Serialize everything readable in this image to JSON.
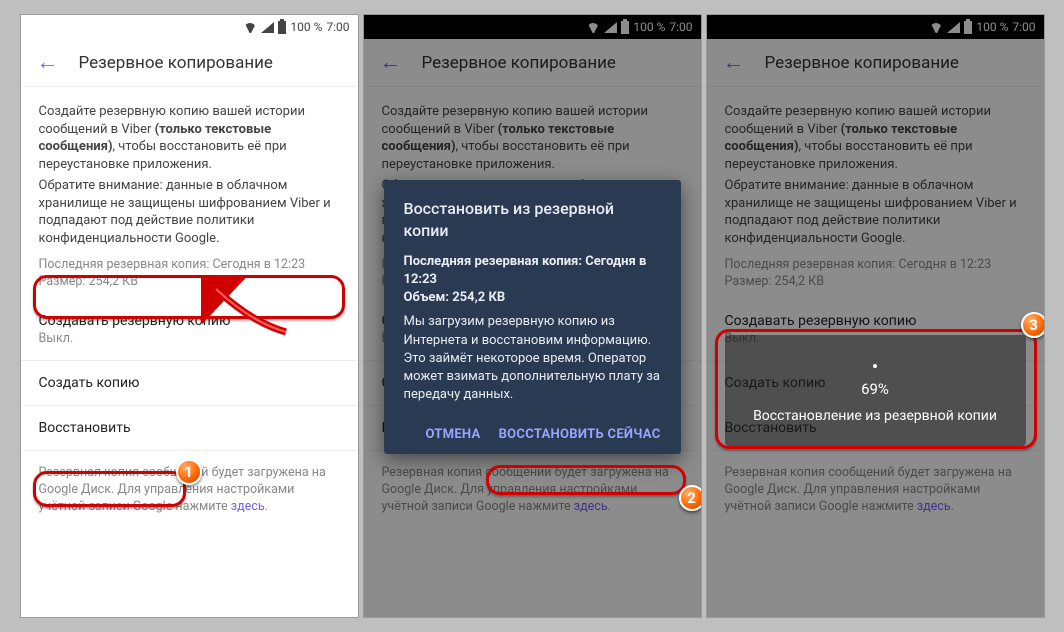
{
  "status": {
    "pct": "100 %",
    "time": "7:00"
  },
  "appbar": {
    "title": "Резервное копирование"
  },
  "desc": {
    "line1a": "Создайте резервную копию вашей истории сообщений в Viber ",
    "line1b": "(только текстовые сообщения)",
    "line1c": ", чтобы восстановить её при переустановке приложения.",
    "line2": "Обратите внимание: данные в облачном хранилище не защищены шифрованием Viber и подпадают под действие политики конфиденциальности Google."
  },
  "last": {
    "line1": "Последняя резервная копия: Сегодня в 12:23",
    "line2": "Размер: 254,2 КВ"
  },
  "rows": {
    "auto": "Создавать резервную копию",
    "auto_sub": "Выкл.",
    "create": "Создать копию",
    "restore": "Восстановить"
  },
  "footer": {
    "text": "Резервная копия сообщений будет загружена на Google Диск. Для управления настройками учётной записи Google нажмите ",
    "link": "здесь"
  },
  "dialog": {
    "title": "Восстановить из резервной копии",
    "b1": "Последняя резервная копия: Сегодня в 12:23",
    "b2": "Объем: 254,2 КВ",
    "body1": "Мы загрузим резервную копию из Интернета и восстановим информацию.",
    "body2": "Это займёт некоторое время. Оператор может взимать дополнительную плату за передачу данных.",
    "cancel": "ОТМЕНА",
    "ok": "ВОССТАНОВИТЬ СЕЙЧАС"
  },
  "progress": {
    "pct": "69%",
    "msg": "Восстановление из резервной копии"
  },
  "badges": {
    "b1": "1",
    "b2": "2",
    "b3": "3"
  }
}
